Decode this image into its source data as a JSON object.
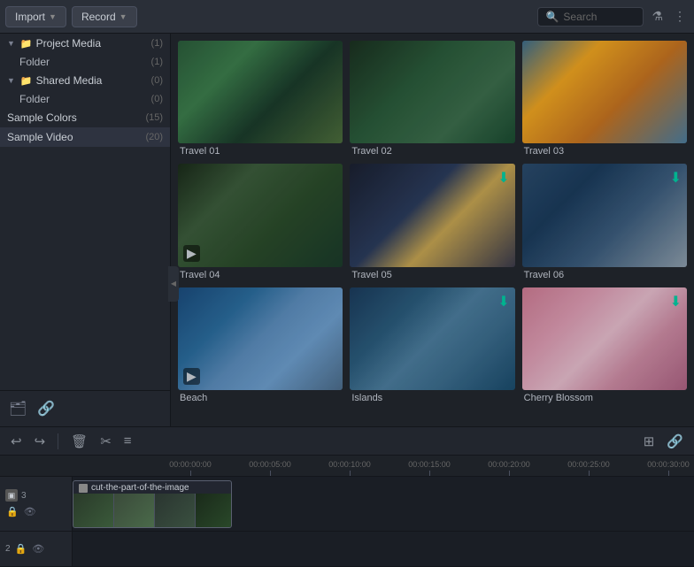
{
  "toolbar": {
    "import_label": "Import",
    "record_label": "Record",
    "search_placeholder": "Search"
  },
  "sidebar": {
    "project_media_label": "Project Media",
    "project_media_count": "(1)",
    "project_media_folder_label": "Folder",
    "project_media_folder_count": "(1)",
    "shared_media_label": "Shared Media",
    "shared_media_count": "(0)",
    "shared_media_folder_label": "Folder",
    "shared_media_folder_count": "(0)",
    "sample_colors_label": "Sample Colors",
    "sample_colors_count": "(15)",
    "sample_video_label": "Sample Video",
    "sample_video_count": "(20)"
  },
  "media_items": [
    {
      "id": "travel01",
      "label": "Travel 01",
      "has_badge": false,
      "thumb_class": "thumb-travel01"
    },
    {
      "id": "travel02",
      "label": "Travel 02",
      "has_badge": false,
      "thumb_class": "thumb-travel02"
    },
    {
      "id": "travel03",
      "label": "Travel 03",
      "has_badge": false,
      "thumb_class": "thumb-travel03"
    },
    {
      "id": "travel04",
      "label": "Travel 04",
      "has_badge": false,
      "thumb_class": "thumb-travel04"
    },
    {
      "id": "travel05",
      "label": "Travel 05",
      "has_badge": true,
      "thumb_class": "thumb-travel05"
    },
    {
      "id": "travel06",
      "label": "Travel 06",
      "has_badge": true,
      "thumb_class": "thumb-travel06"
    },
    {
      "id": "beach",
      "label": "Beach",
      "has_badge": false,
      "thumb_class": "thumb-beach"
    },
    {
      "id": "islands",
      "label": "Islands",
      "has_badge": true,
      "thumb_class": "thumb-islands"
    },
    {
      "id": "cherry",
      "label": "Cherry Blossom",
      "has_badge": true,
      "thumb_class": "thumb-cherry"
    }
  ],
  "timeline": {
    "ruler_marks": [
      "00:00:00:00",
      "00:00:05:00",
      "00:00:10:00",
      "00:00:15:00",
      "00:00:20:00",
      "00:00:25:00",
      "00:00:30:00"
    ],
    "track1_label": "cut-the-part-of-the-image",
    "track1_num": "3",
    "track2_num": "2"
  }
}
